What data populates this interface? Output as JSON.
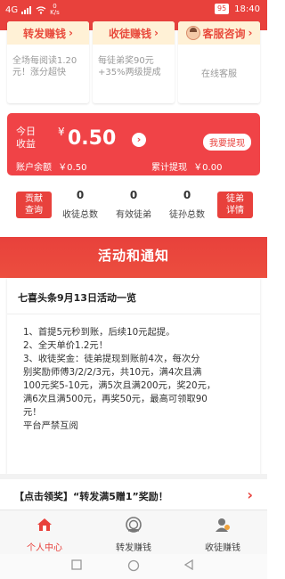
{
  "status_bar": {
    "signal": "4G",
    "net_speed_value": "0",
    "net_speed_unit": "K/s",
    "battery": "95",
    "time": "18:40"
  },
  "cards": [
    {
      "title": "转发赚钱",
      "desc": "全场每阅读1.20元！涨分超快",
      "icon": "chevron-right-icon"
    },
    {
      "title": "收徒赚钱",
      "desc": "每徒弟奖90元+35%两级提成",
      "icon": "chevron-right-icon"
    },
    {
      "title": "客服咨询",
      "desc": "在线客服",
      "icon": "avatar-icon"
    }
  ],
  "earnings": {
    "today_label_line1": "今日",
    "today_label_line2": "收益",
    "currency": "¥",
    "today_amount": "0.50",
    "withdraw_button": "我要提现",
    "balance_label": "账户余额",
    "balance_value": "￥0.50",
    "total_label": "累计提现",
    "total_value": "￥0.00"
  },
  "stats": {
    "left_button_line1": "贡献",
    "left_button_line2": "查询",
    "right_button_line1": "徒弟",
    "right_button_line2": "详情",
    "items": [
      {
        "value": "0",
        "label": "收徒总数"
      },
      {
        "value": "0",
        "label": "有效徒弟"
      },
      {
        "value": "0",
        "label": "徒孙总数"
      }
    ]
  },
  "section_title": "活动和通知",
  "notice": {
    "title": "七喜头条9月13日活动一览",
    "lines": [
      "1、首提5元秒到账，后续10元起提。",
      "2、全天单价1.2元！",
      "3、收徒奖金：徒弟提现到账前4次，每次分",
      "别奖励师傅3/2/2/3元，共10元，满4次且满",
      "100元奖5-10元，满5次且满200元，奖20元，",
      "满6次且满500元，再奖50元，最高可领取90",
      "元！",
      "平台严禁互阅"
    ]
  },
  "promo": {
    "text": "【点击领奖】“转发满5赠1”奖励！"
  },
  "tabs": [
    {
      "label": "个人中心",
      "icon": "home-icon",
      "active": true
    },
    {
      "label": "转发赚钱",
      "icon": "share-coin-icon",
      "active": false
    },
    {
      "label": "收徒赚钱",
      "icon": "user-icon",
      "active": false
    }
  ],
  "colors": {
    "accent": "#e8413c",
    "card_header": "#fff1d6",
    "earn_panel": "#f04347"
  }
}
